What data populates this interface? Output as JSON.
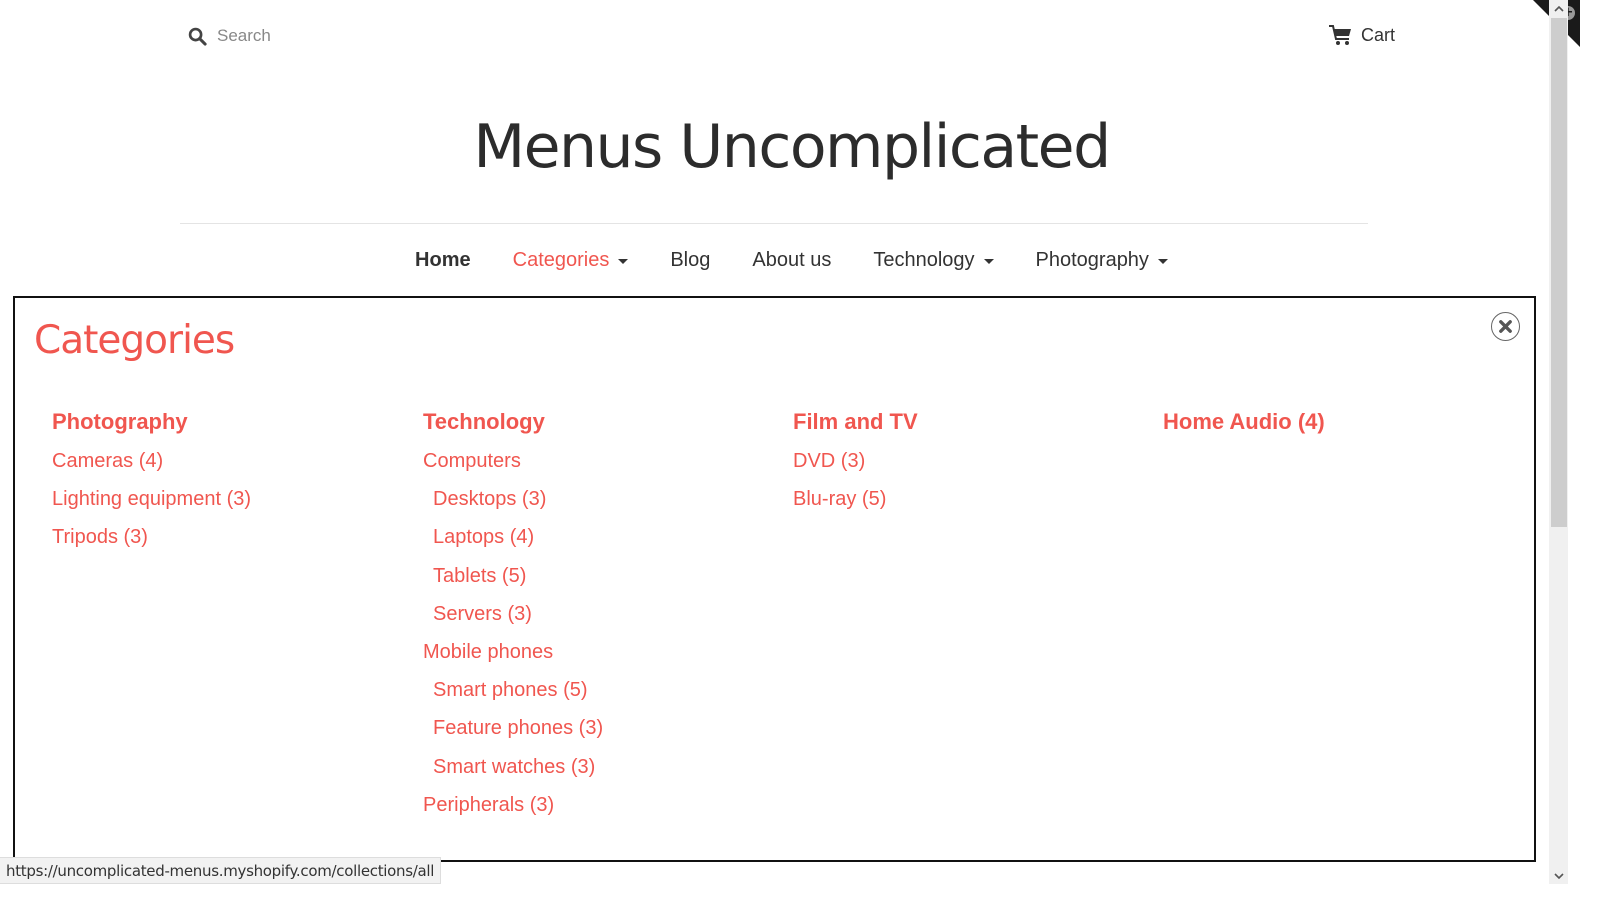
{
  "header": {
    "search": {
      "placeholder": "Search",
      "value": "",
      "icon": "search-icon"
    },
    "cart": {
      "label": "Cart",
      "icon": "cart-icon"
    },
    "corner_badge_icon": "plus-circle-icon",
    "site_title": "Menus Uncomplicated"
  },
  "nav": {
    "items": [
      {
        "label": "Home",
        "has_dropdown": false,
        "state": "current"
      },
      {
        "label": "Categories",
        "has_dropdown": true,
        "state": "open"
      },
      {
        "label": "Blog",
        "has_dropdown": false
      },
      {
        "label": "About us",
        "has_dropdown": false
      },
      {
        "label": "Technology",
        "has_dropdown": true
      },
      {
        "label": "Photography",
        "has_dropdown": true
      }
    ]
  },
  "mega_menu": {
    "title": "Categories",
    "close_icon": "close-circle-icon",
    "columns": [
      {
        "heading": "Photography",
        "links": [
          {
            "label": "Cameras (4)",
            "level": 1
          },
          {
            "label": "Lighting equipment (3)",
            "level": 1
          },
          {
            "label": "Tripods (3)",
            "level": 1
          }
        ]
      },
      {
        "heading": "Technology",
        "links": [
          {
            "label": "Computers",
            "level": 1
          },
          {
            "label": "Desktops (3)",
            "level": 2
          },
          {
            "label": "Laptops (4)",
            "level": 2
          },
          {
            "label": "Tablets (5)",
            "level": 2
          },
          {
            "label": "Servers (3)",
            "level": 2
          },
          {
            "label": "Mobile phones",
            "level": 1
          },
          {
            "label": "Smart phones (5)",
            "level": 2
          },
          {
            "label": "Feature phones (3)",
            "level": 2
          },
          {
            "label": "Smart watches (3)",
            "level": 2
          },
          {
            "label": "Peripherals (3)",
            "level": 1
          }
        ]
      },
      {
        "heading": "Film and TV",
        "links": [
          {
            "label": "DVD (3)",
            "level": 1
          },
          {
            "label": "Blu-ray (5)",
            "level": 1
          }
        ]
      },
      {
        "heading": "Home Audio (4)",
        "links": []
      }
    ]
  },
  "status_bar": {
    "url": "https://uncomplicated-menus.myshopify.com/collections/all"
  },
  "colors": {
    "accent": "#f0564f",
    "text": "#333333",
    "panel_border": "#111111"
  }
}
